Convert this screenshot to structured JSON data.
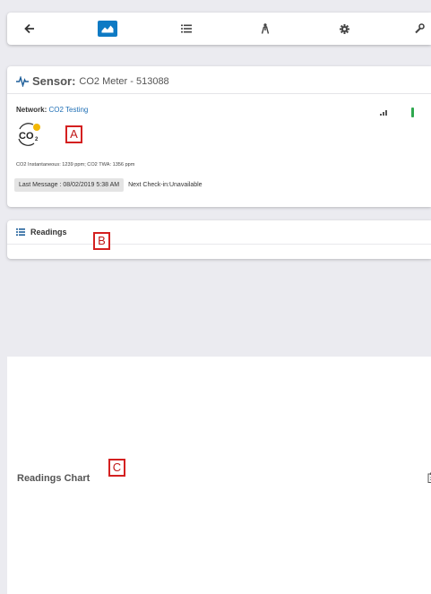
{
  "toolbar": {
    "items": [
      {
        "icon": "back-arrow-icon"
      },
      {
        "icon": "chart-icon",
        "active": true
      },
      {
        "icon": "list-icon"
      },
      {
        "icon": "walker-icon"
      },
      {
        "icon": "gear-icon"
      },
      {
        "icon": "wrench-icon"
      }
    ],
    "accent": "#0e7ac4"
  },
  "sensor": {
    "label": "Sensor:",
    "name": "CO2 Meter - 513088",
    "network_label": "Network:",
    "network_value": "CO2 Testing",
    "measurement": "CO2 Instantaneous: 1239 ppm; CO2 TWA: 1356 ppm",
    "last_message": "Last Message : 08/02/2019 5:38 AM",
    "next_checkin": "Next Check-in:Unavailable",
    "icon": "co2-icon",
    "battery_color": "#2fa84f"
  },
  "readings": {
    "title": "Readings",
    "icon": "list-icon"
  },
  "chart": {
    "title": "Readings Chart",
    "tool_icon": "clipboard-icon"
  },
  "markers": {
    "a": "A",
    "b": "B",
    "c": "C",
    "color": "#d42020"
  }
}
